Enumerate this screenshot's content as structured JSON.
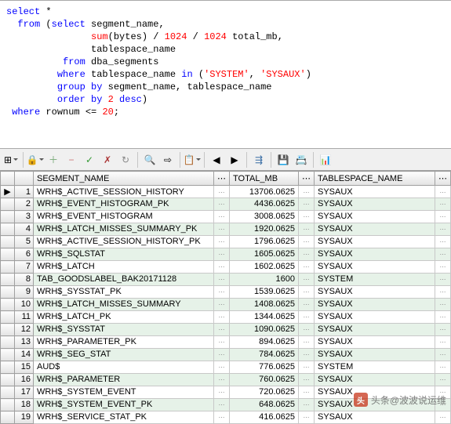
{
  "sql": {
    "l1": {
      "a": "select",
      "rest": " *"
    },
    "l2": {
      "a": "from",
      "b": "select",
      "rest1": "  ",
      "rest2": " (",
      "rest3": " segment_name,"
    },
    "l3": {
      "pad": "               ",
      "fn": "sum",
      "rest1": "(bytes) / ",
      "n1": "1024",
      "rest2": " / ",
      "n2": "1024",
      "rest3": " total_mb,"
    },
    "l4": {
      "pad": "               ",
      "rest": "tablespace_name"
    },
    "l5": {
      "pad": "          ",
      "a": "from",
      "rest": " dba_segments"
    },
    "l6": {
      "pad": "         ",
      "a": "where",
      "rest1": " tablespace_name ",
      "b": "in",
      "rest2": " (",
      "s1": "'SYSTEM'",
      "rest3": ", ",
      "s2": "'SYSAUX'",
      "rest4": ")"
    },
    "l7": {
      "pad": "         ",
      "a": "group",
      "b": "by",
      "rest": " segment_name, tablespace_name"
    },
    "l8": {
      "pad": "         ",
      "a": "order",
      "b": "by",
      "rest1": " ",
      "n": "2",
      "rest2": " ",
      "c": "desc",
      "rest3": ")"
    },
    "l9": {
      "pad": " ",
      "a": "where",
      "rest1": " rownum <= ",
      "n": "20",
      "rest2": ";"
    }
  },
  "headers": {
    "seg": "SEGMENT_NAME",
    "mb": "TOTAL_MB",
    "ts": "TABLESPACE_NAME"
  },
  "rows": [
    {
      "i": "▶",
      "n": "1",
      "seg": "WRH$_ACTIVE_SESSION_HISTORY",
      "mb": "13706.0625",
      "ts": "SYSAUX"
    },
    {
      "i": "",
      "n": "2",
      "seg": "WRH$_EVENT_HISTOGRAM_PK",
      "mb": "4436.0625",
      "ts": "SYSAUX"
    },
    {
      "i": "",
      "n": "3",
      "seg": "WRH$_EVENT_HISTOGRAM",
      "mb": "3008.0625",
      "ts": "SYSAUX"
    },
    {
      "i": "",
      "n": "4",
      "seg": "WRH$_LATCH_MISSES_SUMMARY_PK",
      "mb": "1920.0625",
      "ts": "SYSAUX"
    },
    {
      "i": "",
      "n": "5",
      "seg": "WRH$_ACTIVE_SESSION_HISTORY_PK",
      "mb": "1796.0625",
      "ts": "SYSAUX"
    },
    {
      "i": "",
      "n": "6",
      "seg": "WRH$_SQLSTAT",
      "mb": "1605.0625",
      "ts": "SYSAUX"
    },
    {
      "i": "",
      "n": "7",
      "seg": "WRH$_LATCH",
      "mb": "1602.0625",
      "ts": "SYSAUX"
    },
    {
      "i": "",
      "n": "8",
      "seg": "TAB_GOODSLABEL_BAK20171128",
      "mb": "1600",
      "ts": "SYSTEM"
    },
    {
      "i": "",
      "n": "9",
      "seg": "WRH$_SYSSTAT_PK",
      "mb": "1539.0625",
      "ts": "SYSAUX"
    },
    {
      "i": "",
      "n": "10",
      "seg": "WRH$_LATCH_MISSES_SUMMARY",
      "mb": "1408.0625",
      "ts": "SYSAUX"
    },
    {
      "i": "",
      "n": "11",
      "seg": "WRH$_LATCH_PK",
      "mb": "1344.0625",
      "ts": "SYSAUX"
    },
    {
      "i": "",
      "n": "12",
      "seg": "WRH$_SYSSTAT",
      "mb": "1090.0625",
      "ts": "SYSAUX"
    },
    {
      "i": "",
      "n": "13",
      "seg": "WRH$_PARAMETER_PK",
      "mb": "894.0625",
      "ts": "SYSAUX"
    },
    {
      "i": "",
      "n": "14",
      "seg": "WRH$_SEG_STAT",
      "mb": "784.0625",
      "ts": "SYSAUX"
    },
    {
      "i": "",
      "n": "15",
      "seg": "AUD$",
      "mb": "776.0625",
      "ts": "SYSTEM"
    },
    {
      "i": "",
      "n": "16",
      "seg": "WRH$_PARAMETER",
      "mb": "760.0625",
      "ts": "SYSAUX"
    },
    {
      "i": "",
      "n": "17",
      "seg": "WRH$_SYSTEM_EVENT",
      "mb": "720.0625",
      "ts": "SYSAUX"
    },
    {
      "i": "",
      "n": "18",
      "seg": "WRH$_SYSTEM_EVENT_PK",
      "mb": "648.0625",
      "ts": "SYSAUX"
    },
    {
      "i": "",
      "n": "19",
      "seg": "WRH$_SERVICE_STAT_PK",
      "mb": "416.0625",
      "ts": "SYSAUX"
    }
  ],
  "toolbar_icons": [
    "⊞",
    "🔒",
    "+",
    "−",
    "✓",
    "✗",
    "⟳",
    "🔍",
    "⇥",
    "📋",
    "◀",
    "▶",
    "⇉",
    "💾",
    "🗃",
    "📊"
  ],
  "watermark": {
    "logo": "头",
    "text": "头条@波波说运维"
  }
}
